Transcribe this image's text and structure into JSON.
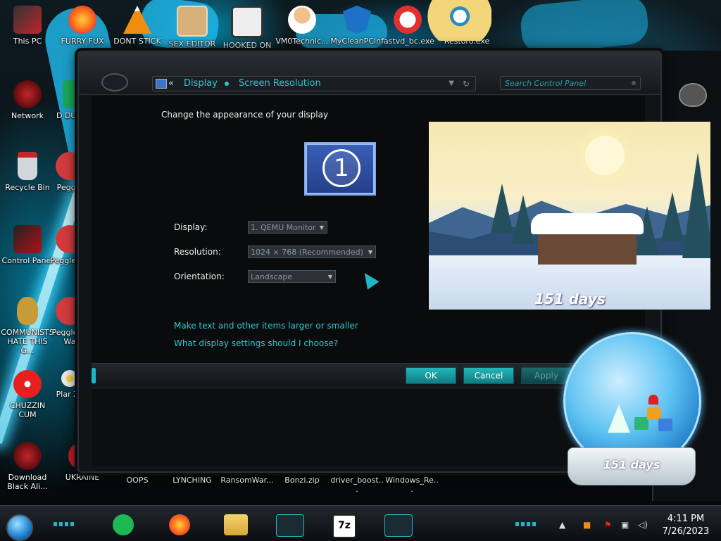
{
  "desktop": {
    "icons": [
      {
        "label": "This PC",
        "color": "#c0262b"
      },
      {
        "label": "FURRY FUX",
        "color": "#ff7a1a"
      },
      {
        "label": "DONT STICK",
        "color": "#f08c10"
      },
      {
        "label": "SEX EDITOR",
        "color": "#d6b27a"
      },
      {
        "label": "HOOKED ON",
        "color": "#444444"
      },
      {
        "label": "VM0Technic...",
        "color": "#f2c08a"
      },
      {
        "label": "MyCleanPCIn...",
        "color": "#1d72c7"
      },
      {
        "label": "fastvd_bc.exe",
        "color": "#e23030"
      },
      {
        "label": "Restoro.exe",
        "color": "#f3d57a"
      },
      {
        "label": "Network",
        "color": "#b3161c"
      },
      {
        "label": "D DUM",
        "color": "#18a85a"
      },
      {
        "label": "Recycle Bin",
        "color": "#d0d6da"
      },
      {
        "label": "Peggle",
        "color": "#d23b3b"
      },
      {
        "label": "Control Panel",
        "color": "#b01018"
      },
      {
        "label": "Peggle De",
        "color": "#d23b3b"
      },
      {
        "label": "COMMUNISTS HATE THIS G...",
        "color": "#c79a3a"
      },
      {
        "label": "Peggle of Wa",
        "color": "#d23b3b"
      },
      {
        "label": "CHUZZIN CUM",
        "color": "#e81f1f"
      },
      {
        "label": "Plar Zo",
        "color": "#e9e9e9"
      },
      {
        "label": "Download Black Ali...",
        "color": "#b3161c"
      },
      {
        "label": "UKRAINE",
        "color": "#c01c22"
      },
      {
        "label": "OOPS",
        "color": "#000000"
      },
      {
        "label": "LYNCHING",
        "color": "#000000"
      },
      {
        "label": "RansomWar...",
        "color": "#000000"
      },
      {
        "label": "Bonzi.zip",
        "color": "#000000"
      },
      {
        "label": "driver_boost...",
        "color": "#000000"
      },
      {
        "label": "Windows_Re...",
        "color": "#000000"
      }
    ]
  },
  "window": {
    "address": {
      "crumb1": "Display",
      "crumb2": "Screen Resolution",
      "back_glyph": "«"
    },
    "search_placeholder": "Search Control Panel",
    "heading": "Change the appearance of your display",
    "monitor_number": "1",
    "fields": {
      "display_label": "Display:",
      "display_value": "1. QEMU Monitor",
      "resolution_label": "Resolution:",
      "resolution_value": "1024 × 768 (Recommended)",
      "orientation_label": "Orientation:",
      "orientation_value": "Landscape"
    },
    "links": {
      "text_size": "Make text and other items larger or smaller",
      "help": "What display settings should I choose?"
    },
    "buttons": {
      "ok": "OK",
      "cancel": "Cancel",
      "apply": "Apply"
    }
  },
  "widgets": {
    "scene_days": "151 days",
    "globe_days": "151 days"
  },
  "taskbar": {
    "time": "4:11 PM",
    "date": "7/26/2023",
    "apps": [
      "start-orb",
      "spotify",
      "firefox",
      "file-explorer",
      "display-app",
      "7zip",
      "alienware-app"
    ],
    "sevenzip_label": "7z"
  },
  "colors": {
    "accent": "#29c9d4",
    "button": "#16a0a5",
    "window_bg": "#111417"
  }
}
